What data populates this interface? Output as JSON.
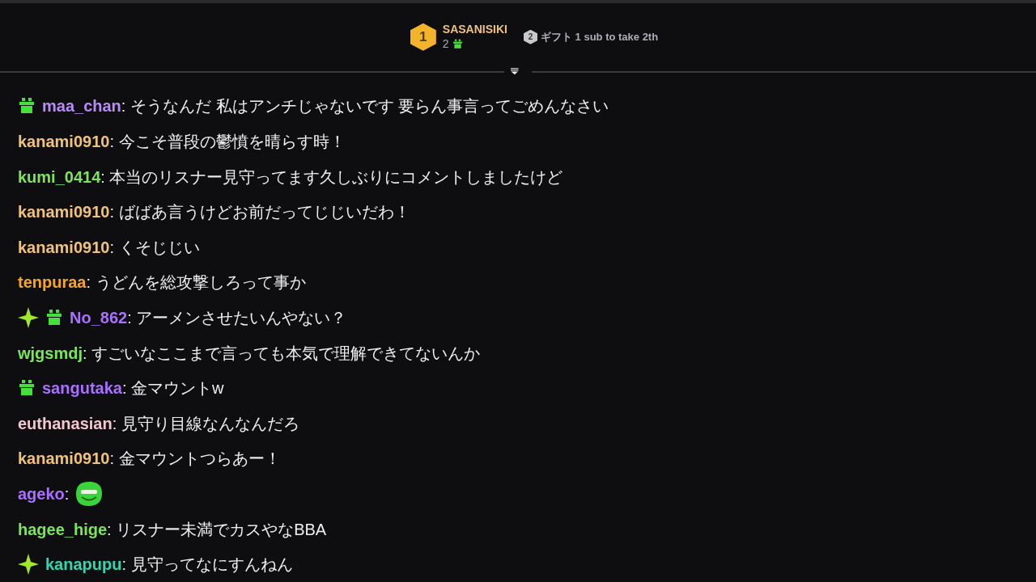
{
  "leaderboard": [
    {
      "rank": "1",
      "name": "SASANISIKI",
      "count": "2"
    },
    {
      "rank": "2",
      "text": "ギフト 1 sub to take 2th"
    }
  ],
  "messages": [
    {
      "badges": [
        {
          "kind": "gift"
        }
      ],
      "user": "maa_chan",
      "color": "#b98cf5",
      "text": ": そうなんだ 私はアンチじゃないです 要らん事言ってごめんなさい"
    },
    {
      "user": "kanami0910",
      "color": "#f0c27a",
      "text": ": 今こそ普段の鬱憤を晴らす時！"
    },
    {
      "user": "kumi_0414",
      "color": "#7be55a",
      "text": ": 本当のリスナー見守ってます久しぶりにコメントしましたけど"
    },
    {
      "user": "kanami0910",
      "color": "#f0c27a",
      "text": ": ばばあ言うけどお前だってじじいだわ！"
    },
    {
      "user": "kanami0910",
      "color": "#f0c27a",
      "text": ": くそじじい"
    },
    {
      "user": "tenpuraa",
      "color": "#f5a623",
      "text": ": うどんを総攻撃しろって事か"
    },
    {
      "badges": [
        {
          "kind": "sparkle"
        },
        {
          "kind": "gift"
        }
      ],
      "user": "No_862",
      "color": "#a970ff",
      "text": ": アーメンさせたいんやない？"
    },
    {
      "user": "wjgsmdj",
      "color": "#7be55a",
      "text": ": すごいなここまで言っても本気で理解できてないんか"
    },
    {
      "badges": [
        {
          "kind": "gift"
        }
      ],
      "user": "sangutaka",
      "color": "#a970ff",
      "text": ": 金マウントw"
    },
    {
      "user": "euthanasian",
      "color": "#f4c6d0",
      "text": ": 見守り目線なんなんだろ"
    },
    {
      "user": "kanami0910",
      "color": "#f0c27a",
      "text": ": 金マウントつらあー！"
    },
    {
      "user": "ageko",
      "color": "#a970ff",
      "text": ":",
      "kind": "emote"
    },
    {
      "user": "hagee_hige",
      "color": "#7be55a",
      "text": ": リスナー未満でカスやなBBA"
    },
    {
      "badges": [
        {
          "kind": "sparkle"
        }
      ],
      "user": "kanapupu",
      "color": "#2fd8b0",
      "text": ": 見守ってなにすんねん"
    }
  ]
}
